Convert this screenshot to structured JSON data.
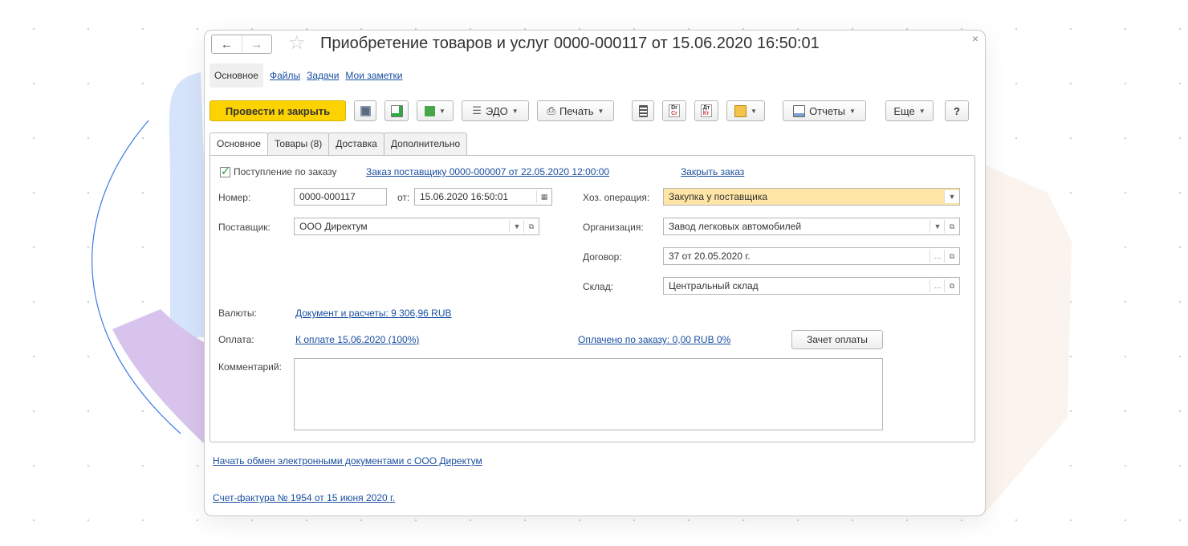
{
  "colors": {
    "accent": "#fcd300",
    "link": "#1a4fa0",
    "highlight": "#ffe6a6"
  },
  "window": {
    "title": "Приобретение товаров и услуг 0000-000117 от 15.06.2020 16:50:01"
  },
  "subnav": {
    "items": [
      "Основное",
      "Файлы",
      "Задачи",
      "Мои заметки"
    ]
  },
  "toolbar": {
    "post_close": "Провести и закрыть",
    "edo": "ЭДО",
    "print": "Печать",
    "reports": "Отчеты",
    "more": "Еще",
    "help": "?",
    "dt_label": "Dr",
    "cr_label": "Cr",
    "dt_ru": "Дт",
    "kt_ru": "Кт"
  },
  "tabs": [
    "Основное",
    "Товары (8)",
    "Доставка",
    "Дополнительно"
  ],
  "form": {
    "order_checkbox_label": "Поступление по заказу",
    "order_link": "Заказ поставщику 0000-000007 от 22.05.2020 12:00:00",
    "close_order": "Закрыть заказ",
    "number_label": "Номер:",
    "number_value": "0000-000117",
    "date_label": "от:",
    "date_value": "15.06.2020 16:50:01",
    "supplier_label": "Поставщик:",
    "supplier_value": "ООО Директум",
    "operation_label": "Хоз. операция:",
    "operation_value": "Закупка у поставщика",
    "org_label": "Организация:",
    "org_value": "Завод легковых автомобилей",
    "contract_label": "Договор:",
    "contract_value": "37 от 20.05.2020 г.",
    "warehouse_label": "Склад:",
    "warehouse_value": "Центральный склад",
    "currency_label": "Валюты:",
    "currency_link": "Документ и расчеты: 9 306,96 RUB",
    "payment_label": "Оплата:",
    "payment_link": "К оплате 15.06.2020 (100%)",
    "paid_link": "Оплачено по заказу: 0,00 RUB  0%",
    "offset_button": "Зачет оплаты",
    "comment_label": "Комментарий:"
  },
  "footer": {
    "edo_link": "Начать обмен электронными документами с ООО Директум",
    "invoice_link": "Счет-фактура № 1954 от 15 июня 2020 г."
  }
}
